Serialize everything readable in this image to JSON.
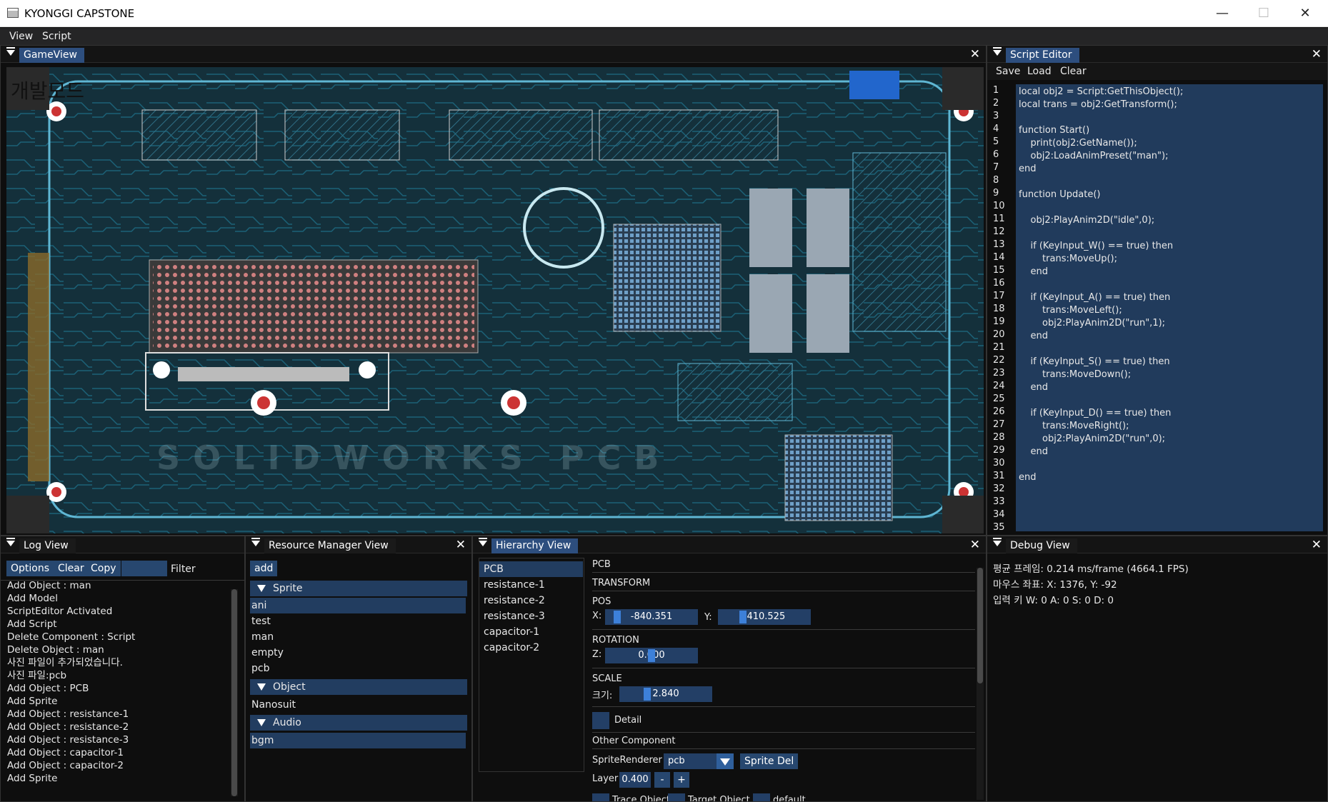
{
  "window": {
    "title": "KYONGGI CAPSTONE",
    "minimize": "—",
    "maximize": "☐",
    "close": "✕"
  },
  "menu": {
    "items": [
      "View",
      "Script"
    ]
  },
  "gameview": {
    "tab": "GameView",
    "mode_label": "개발모드",
    "watermark": "SOLIDWORKS PCB"
  },
  "script_editor": {
    "tab": "Script Editor",
    "toolbar": [
      "Save",
      "Load",
      "Clear"
    ],
    "line_numbers": [
      "1",
      "2",
      "3",
      "4",
      "5",
      "6",
      "7",
      "8",
      "9",
      "10",
      "11",
      "12",
      "13",
      "14",
      "15",
      "16",
      "17",
      "18",
      "19",
      "20",
      "21",
      "22",
      "23",
      "24",
      "25",
      "26",
      "27",
      "28",
      "29",
      "30",
      "31",
      "32",
      "33",
      "34",
      "35"
    ],
    "lines": [
      "local obj2 = Script:GetThisObject();",
      "local trans = obj2:GetTransform();",
      "",
      "function Start()",
      "    print(obj2:GetName());",
      "    obj2:LoadAnimPreset(\"man\");",
      "end",
      "",
      "function Update()",
      "",
      "    obj2:PlayAnim2D(\"idle\",0);",
      "",
      "    if (KeyInput_W() == true) then",
      "        trans:MoveUp();",
      "    end",
      "",
      "    if (KeyInput_A() == true) then",
      "        trans:MoveLeft();",
      "        obj2:PlayAnim2D(\"run\",1);",
      "    end",
      "",
      "    if (KeyInput_S() == true) then",
      "        trans:MoveDown();",
      "    end",
      "",
      "    if (KeyInput_D() == true) then",
      "        trans:MoveRight();",
      "        obj2:PlayAnim2D(\"run\",0);",
      "    end",
      "",
      "end",
      "",
      "",
      "",
      ""
    ]
  },
  "log_view": {
    "tab": "Log View",
    "buttons": {
      "options": "Options",
      "clear": "Clear",
      "copy": "Copy"
    },
    "filter_label": "Filter",
    "filter_value": "",
    "lines": [
      "Add Object : man",
      "Add Model",
      "ScriptEditor Activated",
      "Add Script",
      "Delete Component : Script",
      "Delete Object : man",
      "사진 파일이 추가되었습니다.",
      "사진 파일:pcb",
      "Add Object : PCB",
      "Add Sprite",
      "Add Object : resistance-1",
      "Add Object : resistance-2",
      "Add Object : resistance-3",
      "Add Object : capacitor-1",
      "Add Object : capacitor-2",
      "Add Sprite"
    ]
  },
  "resource_manager": {
    "tab": "Resource Manager View",
    "add_button": "add",
    "groups": [
      {
        "name": "Sprite",
        "items": [
          "ani",
          "test",
          "man",
          "empty",
          "pcb"
        ]
      },
      {
        "name": "Object",
        "items": [
          "Nanosuit"
        ]
      },
      {
        "name": "Audio",
        "items": [
          "bgm"
        ]
      }
    ]
  },
  "hierarchy": {
    "tab": "Hierarchy View",
    "objects": [
      "PCB",
      "resistance-1",
      "resistance-2",
      "resistance-3",
      "capacitor-1",
      "capacitor-2"
    ],
    "selected": "PCB",
    "inspector": {
      "name": "PCB",
      "transform_label": "TRANSFORM",
      "pos_label": "POS",
      "x_label": "X:",
      "x_value": "-840.351",
      "y_label": "Y:",
      "y_value": "-410.525",
      "rotation_label": "ROTATION",
      "z_label": "Z:",
      "z_value": "0.000",
      "scale_label": "SCALE",
      "size_label": "크기:",
      "size_value": "2.840",
      "detail_label": "Detail",
      "other_label": "Other Component",
      "sprite_renderer_label": "SpriteRenderer",
      "sprite_value": "pcb",
      "sprite_del": "Sprite Del",
      "layer_label": "Layer",
      "layer_value": "0.400",
      "layer_minus": "-",
      "layer_plus": "+",
      "trace_object": "Trace Object",
      "target_object": "Target Object",
      "default_label": "default"
    }
  },
  "debug_view": {
    "tab": "Debug View",
    "lines": [
      "평균 프레임: 0.214 ms/frame (4664.1 FPS)",
      "마우스 좌표: X: 1376, Y: -92",
      "입력 키 W: 0 A: 0 S: 0 D: 0"
    ]
  }
}
